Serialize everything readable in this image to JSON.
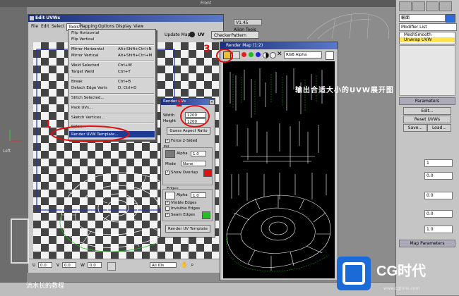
{
  "viewport": {
    "left_label": "Left",
    "axis": [
      "x",
      "y"
    ],
    "top_label": "Front"
  },
  "command_panel": {
    "object_field": "輸面",
    "modifier_list": "Modifier List",
    "stack": [
      "MeshSmooth",
      "Unwrap UVW"
    ],
    "sections": [
      "Parameters",
      "Map Parameters"
    ],
    "spinner_values": [
      "0.0",
      "1",
      "0.0",
      "0.0",
      "1.0"
    ],
    "buttons": [
      "Edit...",
      "Reset UVWs",
      "Save...",
      "Load..."
    ]
  },
  "uvw": {
    "title": "Edit UVWs",
    "menus": [
      "File",
      "Edit",
      "Select",
      "Tools",
      "Mapping",
      "Options",
      "Display",
      "View"
    ],
    "version": "V1.45",
    "align_tools": "Align Tools",
    "update_map": "Update Map",
    "uv_label": "UV",
    "checker": "CheckerPattern",
    "bottom": {
      "u_value": "0.0",
      "v_value": "0.0",
      "w_value": "0.0",
      "ids": "All IDs"
    }
  },
  "tools_menu": {
    "items": [
      {
        "label": "Flip Horizontal",
        "shortcut": ""
      },
      {
        "label": "Flip Vertical",
        "shortcut": ""
      },
      {
        "label": "Mirror Horizontal",
        "shortcut": "Alt+Shift+Ctrl+N"
      },
      {
        "label": "Mirror Vertical",
        "shortcut": "Alt+Shift+Ctrl+M"
      },
      {
        "label": "Weld Selected",
        "shortcut": "Ctrl+W"
      },
      {
        "label": "Target Weld",
        "shortcut": "Ctrl+T"
      },
      {
        "label": "Break",
        "shortcut": "Ctrl+B"
      },
      {
        "label": "Detach Edge Verts",
        "shortcut": "D, Ctrl+D"
      },
      {
        "label": "Stitch Selected...",
        "shortcut": ""
      },
      {
        "label": "Pack UVs...",
        "shortcut": ""
      },
      {
        "label": "Sketch Vertices...",
        "shortcut": ""
      },
      {
        "label": "Relax...",
        "shortcut": ""
      },
      {
        "label": "Render UVW Template...",
        "shortcut": ""
      }
    ]
  },
  "render_uvs": {
    "title": "Render UVs",
    "width_label": "Width",
    "height_label": "Height",
    "width_value": "1200",
    "height_value": "1200",
    "guess_aspect": "Guess Aspect Ratio",
    "force_2sided": "Force 2-Sided",
    "fill_label": "Fill",
    "alpha_label": "Alpha",
    "fill_alpha": "1.0",
    "mode_label": "Mode",
    "mode_value": "None",
    "show_overlap": "Show Overlap",
    "edges_label": "Edges",
    "edge_alpha": "1.0",
    "visible_edges": "Visible Edges",
    "invisible_edges": "Invisible Edges",
    "seam_edges": "Seam Edges",
    "render_button": "Render UV Template",
    "overlap_color": "#e01010",
    "seam_color": "#22c022"
  },
  "render_map": {
    "title": "Render Map (1:2)",
    "channel": "RGB Alpha",
    "annotation": "输出合适大小的UVW展开图"
  },
  "annotations": {
    "step1": "1",
    "step2": "2",
    "step3": "3"
  },
  "branding": {
    "watermark": "流水长的教程",
    "logo": "CG时代",
    "url": "www.cgtime.com"
  }
}
